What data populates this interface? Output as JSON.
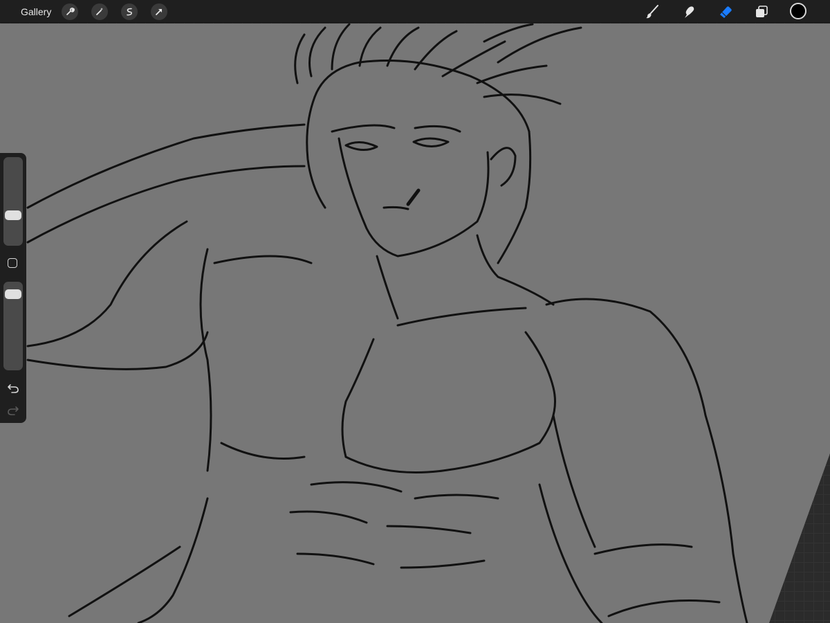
{
  "app": {
    "accent_color": "#1a7cff",
    "canvas_color": "#777777",
    "workspace_color": "#2b2b2b",
    "bar_color": "#1f1f1f"
  },
  "topbar": {
    "gallery_label": "Gallery",
    "left_tools": [
      "wrench-icon",
      "magic-wand-icon",
      "selection-icon",
      "transform-arrow-icon"
    ],
    "right_tools": [
      "brush-icon",
      "smudge-icon",
      "eraser-icon",
      "layers-icon"
    ],
    "active_tool": "eraser",
    "current_color": "#000000"
  },
  "sidebar": {
    "brush_size": 0.32,
    "opacity": 0.92,
    "buttons": [
      "modify-square-icon",
      "undo-icon",
      "redo-icon"
    ]
  }
}
